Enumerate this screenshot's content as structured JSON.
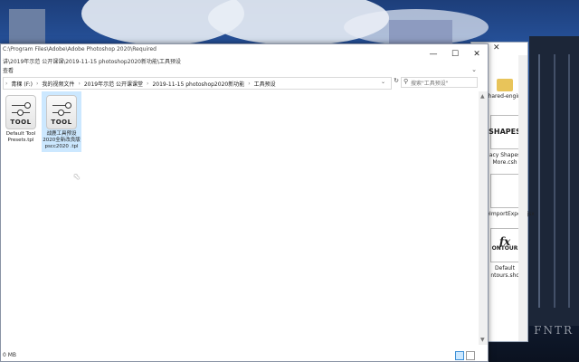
{
  "explorer": {
    "title": "C:\\Program Files\\Adobe\\Adobe Photoshop 2020\\Required",
    "path_secondary": "讲\\2019年示范 公开课课\\2019-11-15 photoshop2020新功能\\工具预设",
    "menu_label": "查看",
    "address": {
      "crumbs": [
        "青稞 (F:)",
        "我的视频文件",
        "2019年示范 公开课课堂",
        "2019-11-15 photoshop2020新功能",
        "工具预设"
      ]
    },
    "search_placeholder": "搜索\"工具预设\"",
    "items": [
      {
        "icon": "tool-preset-icon",
        "icon_text": "TOOL",
        "label": "Default Tool Presets.tpl",
        "selected": false
      },
      {
        "icon": "tool-preset-icon",
        "icon_text": "TOOL",
        "label": "战鹿工具预设2020全新改良版 pscc2020 .tpl",
        "selected": true
      }
    ],
    "status": "0 MB"
  },
  "back_window": {
    "items": [
      {
        "label": "shared-engine",
        "icon": "folder-icon"
      },
      {
        "label": "acy Shapes More.csh",
        "icon_text": "SHAPES",
        "icon": "shapes-icon"
      },
      {
        "label": "teImportExport.jsx",
        "icon": "file-icon"
      },
      {
        "label": "Default ntours.shc",
        "icon_text": "ONTOUR",
        "icon": "contour-icon"
      }
    ]
  },
  "desktop": {
    "watermark": "FNTR"
  }
}
